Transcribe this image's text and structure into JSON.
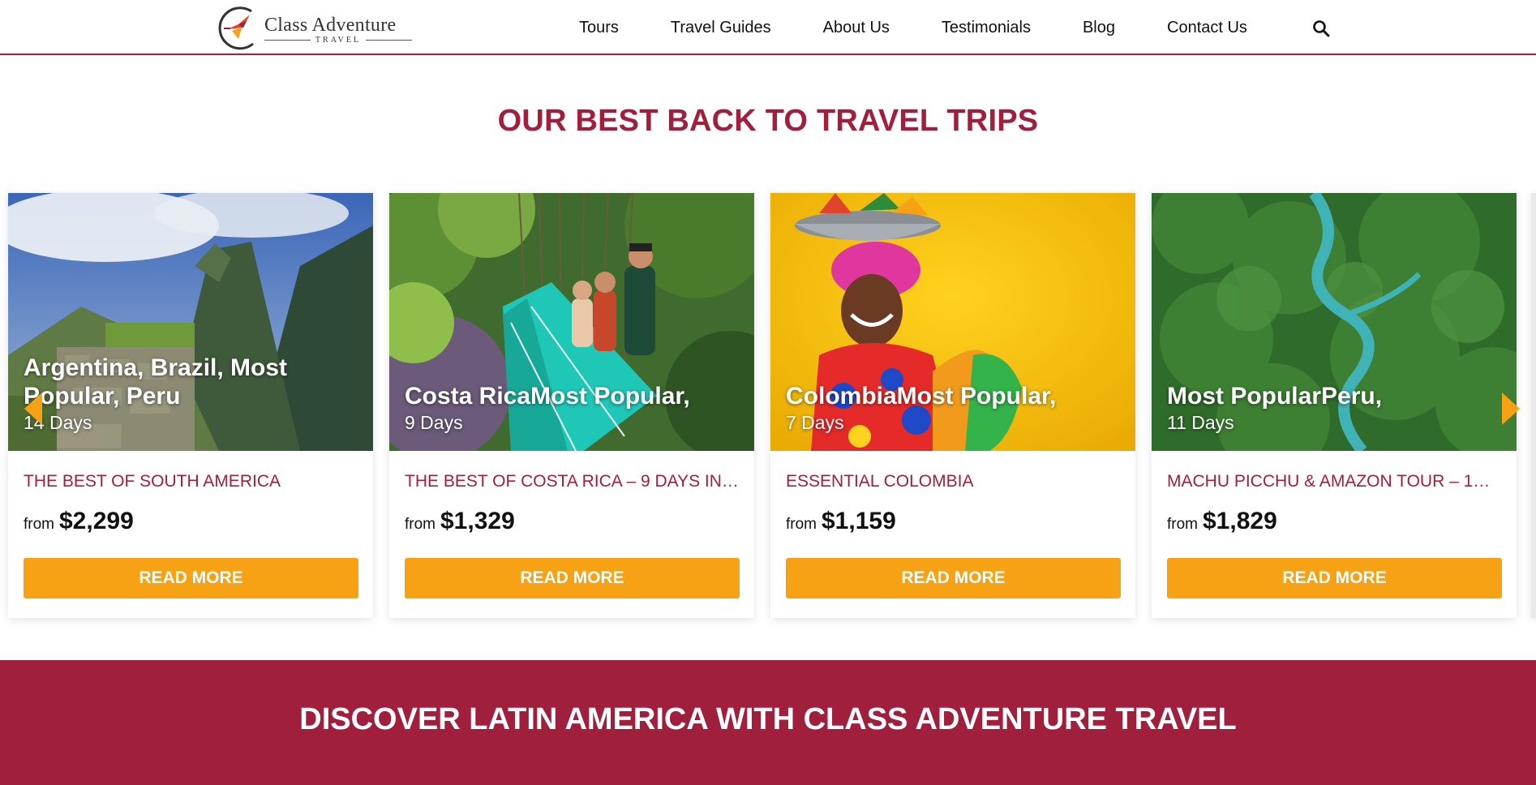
{
  "header": {
    "logo": {
      "name": "Class Adventure",
      "sub": "TRAVEL"
    },
    "nav": [
      {
        "label": "Tours"
      },
      {
        "label": "Travel Guides"
      },
      {
        "label": "About Us"
      },
      {
        "label": "Testimonials"
      },
      {
        "label": "Blog"
      },
      {
        "label": "Contact Us"
      }
    ],
    "search_icon": "search-icon"
  },
  "section": {
    "title": "OUR BEST BACK TO TRAVEL TRIPS"
  },
  "trips": [
    {
      "overlay_title": "Argentina, Brazil, Most Popular, Peru",
      "days": "14 Days",
      "name": "THE BEST OF SOUTH AMERICA",
      "from_label": "from",
      "price": "$2,299",
      "button": "READ MORE"
    },
    {
      "overlay_title": "Costa RicaMost Popular,",
      "days": "9 Days",
      "name": "THE BEST OF COSTA RICA – 9 DAYS IN…",
      "from_label": "from",
      "price": "$1,329",
      "button": "READ MORE"
    },
    {
      "overlay_title": "ColombiaMost Popular,",
      "days": "7 Days",
      "name": "ESSENTIAL COLOMBIA",
      "from_label": "from",
      "price": "$1,159",
      "button": "READ MORE"
    },
    {
      "overlay_title": "Most PopularPeru,",
      "days": "11 Days",
      "name": "MACHU PICCHU & AMAZON TOUR – 1…",
      "from_label": "from",
      "price": "$1,829",
      "button": "READ MORE"
    }
  ],
  "carousel": {
    "prev_icon": "chevron-left-icon",
    "next_icon": "chevron-right-icon"
  },
  "banner": {
    "text": "DISCOVER LATIN AMERICA WITH CLASS ADVENTURE TRAVEL"
  },
  "colors": {
    "brand": "#a01f3d",
    "accent": "#f7a114"
  }
}
